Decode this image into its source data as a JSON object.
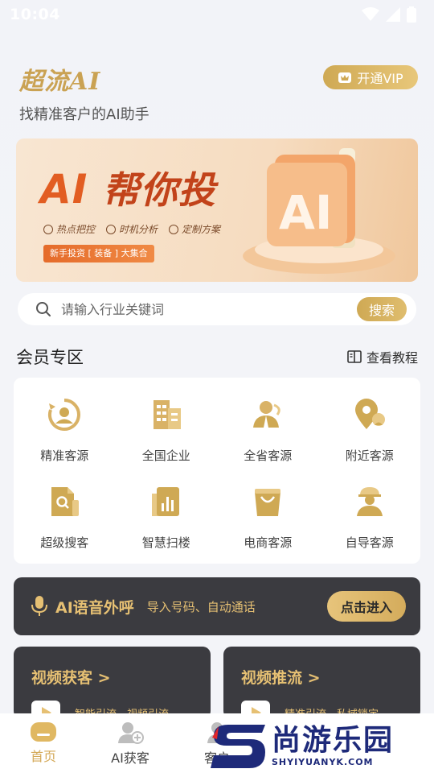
{
  "status_bar": {
    "time": "10:04"
  },
  "header": {
    "title": "超流AI",
    "subtitle": "找精准客户的AI助手",
    "vip_label": "开通VIP"
  },
  "banner": {
    "title_ai": "AI",
    "title_cn": "帮你投",
    "features": [
      "热点把控",
      "时机分析",
      "定制方案"
    ],
    "tag": "新手投资 [ 装备 ] 大集合",
    "art_label": "AI"
  },
  "search": {
    "placeholder": "请输入行业关键词",
    "button_label": "搜索"
  },
  "member_section": {
    "title": "会员专区",
    "tutorial_label": "查看教程",
    "items": [
      {
        "label": "精准客源",
        "icon": "target-user-icon"
      },
      {
        "label": "全国企业",
        "icon": "building-icon"
      },
      {
        "label": "全省客源",
        "icon": "business-user-icon"
      },
      {
        "label": "附近客源",
        "icon": "location-pin-icon"
      },
      {
        "label": "超级搜客",
        "icon": "document-search-icon"
      },
      {
        "label": "智慧扫楼",
        "icon": "bar-chart-icon"
      },
      {
        "label": "电商客源",
        "icon": "shopping-bag-icon"
      },
      {
        "label": "自导客源",
        "icon": "worker-icon"
      }
    ]
  },
  "voice_call": {
    "title": "AI语音外呼",
    "desc": "导入号码、自动通话",
    "button_label": "点击进入"
  },
  "promo_cards": [
    {
      "title": "视频获客 >",
      "desc": "智能引流、视频引流"
    },
    {
      "title": "视频推流 >",
      "desc": "精准引流、私域锁定"
    }
  ],
  "tab_bar": {
    "items": [
      {
        "label": "首页",
        "active": true
      },
      {
        "label": "AI获客",
        "active": false
      },
      {
        "label": "客户",
        "active": false
      }
    ]
  },
  "watermark": {
    "cn": "尚游乐园",
    "en": "SHYIYUANYK.COM"
  },
  "colors": {
    "accent": "#cfa954",
    "dark_card": "#3b3b40",
    "banner_red": "#e25d22"
  }
}
